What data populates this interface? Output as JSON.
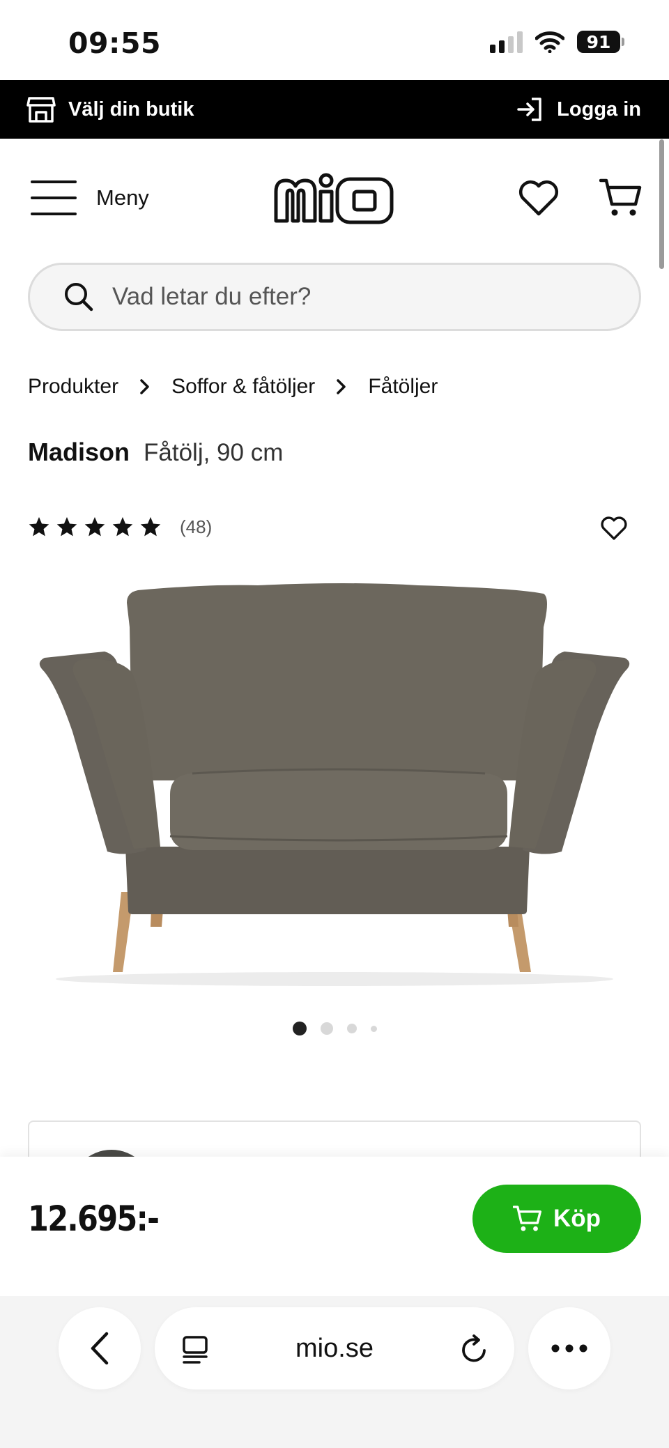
{
  "status_bar": {
    "time": "09:55",
    "battery": "91"
  },
  "store_bar": {
    "store_label": "Välj din butik",
    "login_label": "Logga in"
  },
  "header": {
    "menu_label": "Meny",
    "logo_text": "mio"
  },
  "search": {
    "placeholder": "Vad letar du efter?"
  },
  "breadcrumb": [
    "Produkter",
    "Soffor & fåtöljer",
    "Fåtöljer"
  ],
  "product": {
    "name": "Madison",
    "description": "Fåtölj, 90 cm",
    "rating_stars": 5,
    "review_count": "(48)",
    "price": "12.695:-",
    "buy_label": "Köp",
    "image_count": 4,
    "active_image": 1
  },
  "browser": {
    "url": "mio.se"
  },
  "colors": {
    "accent_green": "#1db117",
    "store_bar_bg": "#000000",
    "sofa_fabric": "#6b665c",
    "legs_wood": "#c49a6c"
  },
  "icons": [
    "store-icon",
    "login-icon",
    "menu-icon",
    "heart-icon",
    "cart-icon",
    "search-icon",
    "chevron-right-icon",
    "star-icon",
    "back-icon",
    "reader-icon",
    "reload-icon",
    "more-icon"
  ]
}
